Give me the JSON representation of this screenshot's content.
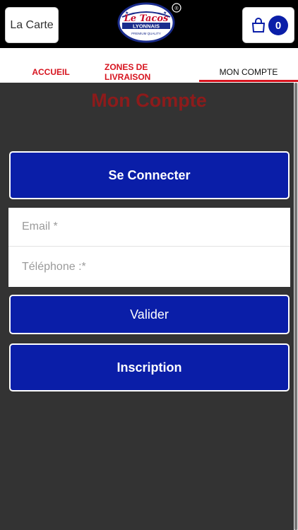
{
  "header": {
    "menu_label": "La Carte",
    "logo": {
      "line1": "Le Tacos",
      "line2": "LYONNAIS",
      "tagline": "PREMIUM QUALITY"
    },
    "cart_count": "0",
    "cart_icon": "shopping-bag-icon"
  },
  "tabs": [
    {
      "label": "ACCUEIL"
    },
    {
      "label": "ZONES DE LIVRAISON"
    },
    {
      "label": "MON COMPTE"
    }
  ],
  "main": {
    "title": "Mon Compte",
    "connect_label": "Se Connecter",
    "email_placeholder": "Email *",
    "phone_placeholder": "Téléphone :*",
    "submit_label": "Valider",
    "register_label": "Inscription"
  },
  "colors": {
    "header_bg": "#000000",
    "accent_red": "#d7141f",
    "title_red": "#8d1b1b",
    "button_blue": "#0a1ea8",
    "content_bg": "#333333"
  }
}
